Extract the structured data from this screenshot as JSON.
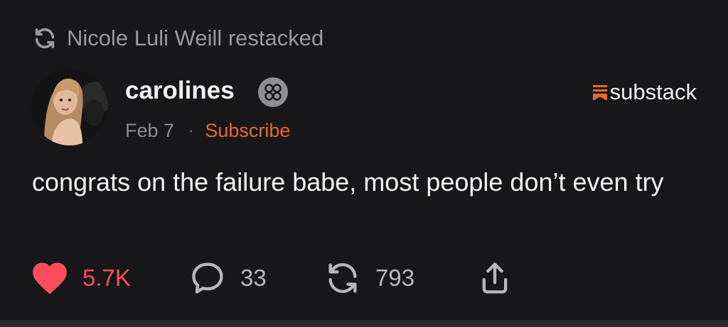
{
  "restack": {
    "icon": "restack-icon",
    "text": "Nicole Luli Weill restacked"
  },
  "post": {
    "author": "carolines",
    "date": "Feb 7",
    "separator": "·",
    "subscribe_label": "Subscribe",
    "body": "congrats on the failure babe, most people don’t even try"
  },
  "brand": {
    "name": "substack",
    "accent": "#e8692d"
  },
  "actions": {
    "likes": "5.7K",
    "comments": "33",
    "restacks": "793"
  },
  "colors": {
    "background": "#17171a",
    "like": "#ff4d5e",
    "accent": "#e8692d",
    "muted": "#9a9a9e"
  }
}
